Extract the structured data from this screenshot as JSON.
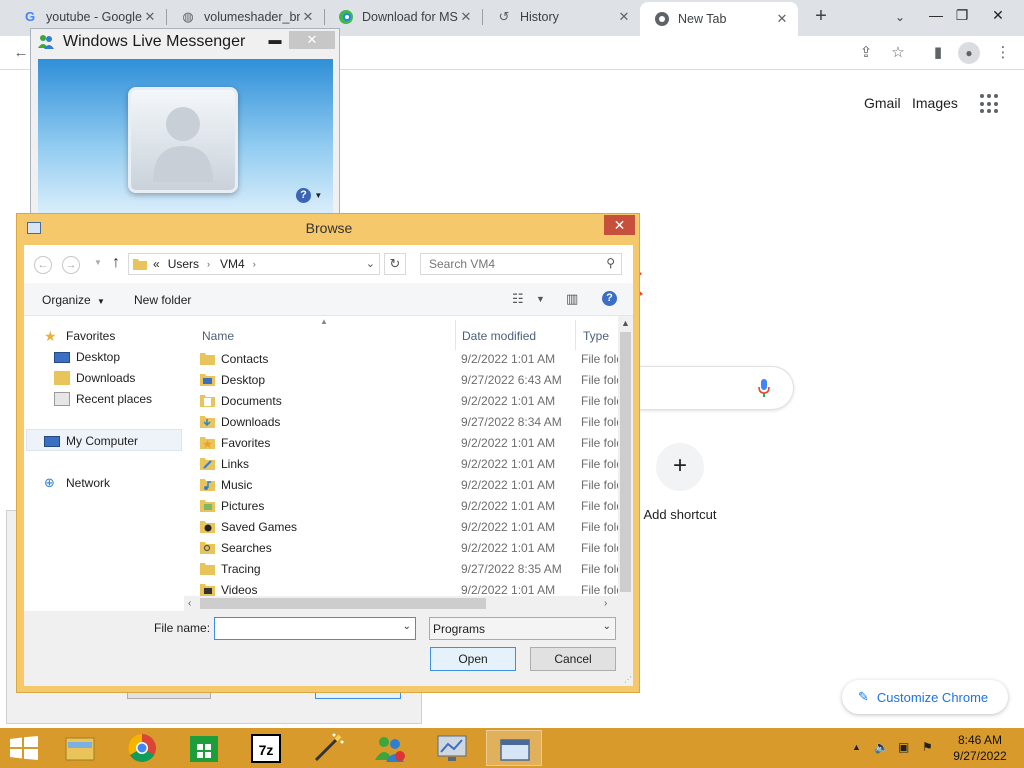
{
  "chrome": {
    "tabs": [
      {
        "title": "youtube - Google",
        "icon": "google-g-icon"
      },
      {
        "title": "volumeshader_bm",
        "icon": "globe-icon"
      },
      {
        "title": "Download for MS",
        "icon": "edge-icon"
      },
      {
        "title": "History",
        "icon": "history-icon"
      },
      {
        "title": "New Tab",
        "icon": "chrome-icon",
        "active": true
      }
    ],
    "new_tab_symbol": "+"
  },
  "ntp": {
    "links": [
      "Gmail",
      "Images"
    ],
    "add_shortcut_label": "Add shortcut",
    "customize_label": "Customize Chrome",
    "accent": "#1a73e8"
  },
  "messenger": {
    "title": "Windows Live Messenger",
    "help_symbol": "?"
  },
  "dialog": {
    "title": "Browse",
    "breadcrumb": [
      "Users",
      "VM4"
    ],
    "crumb_prefix": "«",
    "search_placeholder": "Search VM4",
    "organize_label": "Organize",
    "new_folder_label": "New folder",
    "nav": {
      "favorites": "Favorites",
      "favorite_items": [
        "Desktop",
        "Downloads",
        "Recent places"
      ],
      "computer": "My Computer",
      "network": "Network"
    },
    "columns": {
      "name": "Name",
      "date": "Date modified",
      "type": "Type"
    },
    "files": [
      {
        "name": "Contacts",
        "date": "9/2/2022 1:01 AM",
        "type": "File folder"
      },
      {
        "name": "Desktop",
        "date": "9/27/2022 6:43 AM",
        "type": "File folder"
      },
      {
        "name": "Documents",
        "date": "9/2/2022 1:01 AM",
        "type": "File folder"
      },
      {
        "name": "Downloads",
        "date": "9/27/2022 8:34 AM",
        "type": "File folder"
      },
      {
        "name": "Favorites",
        "date": "9/2/2022 1:01 AM",
        "type": "File folder"
      },
      {
        "name": "Links",
        "date": "9/2/2022 1:01 AM",
        "type": "File folder"
      },
      {
        "name": "Music",
        "date": "9/2/2022 1:01 AM",
        "type": "File folder"
      },
      {
        "name": "Pictures",
        "date": "9/2/2022 1:01 AM",
        "type": "File folder"
      },
      {
        "name": "Saved Games",
        "date": "9/2/2022 1:01 AM",
        "type": "File folder"
      },
      {
        "name": "Searches",
        "date": "9/2/2022 1:01 AM",
        "type": "File folder"
      },
      {
        "name": "Tracing",
        "date": "9/27/2022 8:35 AM",
        "type": "File folder"
      },
      {
        "name": "Videos",
        "date": "9/2/2022 1:01 AM",
        "type": "File folder"
      }
    ],
    "file_name_label": "File name:",
    "file_name_value": "",
    "file_type_value": "Programs",
    "open_label": "Open",
    "cancel_label": "Cancel",
    "title_bar_color": "#f6c86c"
  },
  "taskbar": {
    "color": "#d99a2c",
    "apps": [
      "file-explorer-icon",
      "chrome-icon",
      "store-icon",
      "7zip-icon",
      "wand-icon",
      "messenger-icon",
      "monitor-icon",
      "browse-window-icon"
    ],
    "time": "8:46 AM",
    "date": "9/27/2022"
  }
}
